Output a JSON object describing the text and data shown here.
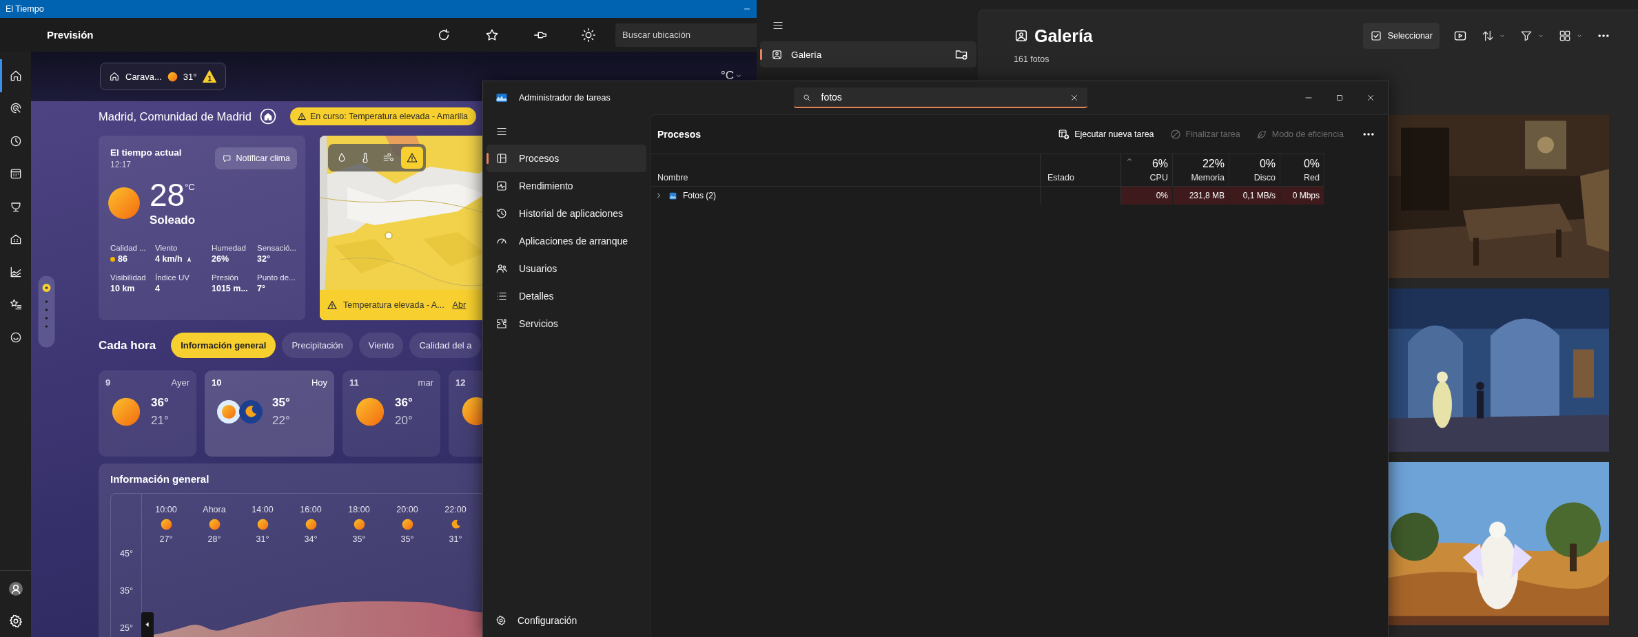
{
  "weather_app": {
    "window": {
      "title": "El Tiempo"
    },
    "header": {
      "title": "Previsión",
      "search": {
        "placeholder": "Buscar ubicación"
      }
    },
    "nav": [
      {
        "kind": "home",
        "selected": true
      },
      {
        "kind": "radar",
        "selected": false
      },
      {
        "kind": "clock",
        "selected": false
      },
      {
        "kind": "calendar",
        "selected": false
      },
      {
        "kind": "trophy",
        "selected": false
      },
      {
        "kind": "building",
        "selected": false
      },
      {
        "kind": "chart",
        "selected": false
      },
      {
        "kind": "starlist",
        "selected": false
      },
      {
        "kind": "smiley",
        "selected": false
      }
    ],
    "saved_location": {
      "name": "Carava...",
      "temp": "31°",
      "alerts": "1"
    },
    "unit": "°C",
    "location": "Madrid, Comunidad de Madrid",
    "alert": "En curso: Temperatura elevada - Amarilla",
    "current": {
      "title": "El tiempo actual",
      "time": "12:17",
      "notify": "Notificar clima",
      "temp": "28",
      "unit": "°C",
      "condition": "Soleado",
      "stats": [
        {
          "kind": "air",
          "label": "Calidad ...",
          "value": "86"
        },
        {
          "kind": "wind",
          "label": "Viento",
          "value": "4 km/h"
        },
        {
          "kind": "plain",
          "label": "Humedad",
          "value": "26%"
        },
        {
          "kind": "plain",
          "label": "Sensació...",
          "value": "32°"
        },
        {
          "kind": "plain",
          "label": "Visibilidad",
          "value": "10 km"
        },
        {
          "kind": "plain",
          "label": "Índice UV",
          "value": "4"
        },
        {
          "kind": "plain",
          "label": "Presión",
          "value": "1015 m..."
        },
        {
          "kind": "plain",
          "label": "Punto de...",
          "value": "7°"
        }
      ]
    },
    "map": {
      "layers": [
        {
          "kind": "precipitation",
          "selected": false
        },
        {
          "kind": "temperature",
          "selected": false
        },
        {
          "kind": "wind",
          "selected": false
        },
        {
          "kind": "alert",
          "selected": true
        }
      ],
      "alert": "Temperatura elevada - A...",
      "link": "Abr"
    },
    "hourly": {
      "title": "Cada hora",
      "tabs": [
        {
          "label": "Información general",
          "selected": true
        },
        {
          "label": "Precipitación",
          "selected": false
        },
        {
          "label": "Viento",
          "selected": false
        },
        {
          "label": "Calidad del a",
          "selected": false
        }
      ]
    },
    "days": [
      {
        "day": "9",
        "label": "Ayer",
        "kind": "sun",
        "high": "36°",
        "low": "21°",
        "selected": false
      },
      {
        "day": "10",
        "label": "Hoy",
        "kind": "day-night",
        "high": "35°",
        "low": "22°",
        "selected": true
      },
      {
        "day": "11",
        "label": "mar",
        "kind": "sun",
        "high": "36°",
        "low": "20°",
        "selected": false
      },
      {
        "day": "12",
        "kind": "sun",
        "selected": false
      }
    ],
    "overview": {
      "title": "Información general",
      "hours": [
        {
          "time": "10:00",
          "kind": "sun",
          "temp": "27°"
        },
        {
          "time": "Ahora",
          "kind": "sun",
          "temp": "28°"
        },
        {
          "time": "14:00",
          "kind": "sun",
          "temp": "31°"
        },
        {
          "time": "16:00",
          "kind": "sun",
          "temp": "34°"
        },
        {
          "time": "18:00",
          "kind": "sun",
          "temp": "35°"
        },
        {
          "time": "20:00",
          "kind": "sun",
          "temp": "35°"
        },
        {
          "time": "22:00",
          "kind": "moon",
          "temp": "31°"
        }
      ],
      "yticks": [
        "45°",
        "35°",
        "25°"
      ]
    }
  },
  "task_manager": {
    "title": "Administrador de tareas",
    "search": {
      "value": "fotos"
    },
    "nav": [
      {
        "kind": "processes",
        "label": "Procesos",
        "selected": true
      },
      {
        "kind": "performance",
        "label": "Rendimiento",
        "selected": false
      },
      {
        "kind": "history",
        "label": "Historial de aplicaciones",
        "selected": false
      },
      {
        "kind": "startup",
        "label": "Aplicaciones de arranque",
        "selected": false
      },
      {
        "kind": "users",
        "label": "Usuarios",
        "selected": false
      },
      {
        "kind": "details",
        "label": "Detalles",
        "selected": false
      },
      {
        "kind": "services",
        "label": "Servicios",
        "selected": false
      }
    ],
    "settings": "Configuración",
    "page_title": "Procesos",
    "actions": [
      {
        "kind": "run",
        "label": "Ejecutar nueva tarea",
        "disabled": false
      },
      {
        "kind": "end",
        "label": "Finalizar tarea",
        "disabled": true
      },
      {
        "kind": "efficiency",
        "label": "Modo de eficiencia",
        "disabled": true
      }
    ],
    "columns": [
      {
        "label": "Nombre"
      },
      {
        "label": "Estado"
      },
      {
        "label": "CPU",
        "total": "6%",
        "sorted": true
      },
      {
        "label": "Memoria",
        "total": "22%",
        "sorted": false
      },
      {
        "label": "Disco",
        "total": "0%",
        "sorted": false
      },
      {
        "label": "Red",
        "total": "0%",
        "sorted": false
      }
    ],
    "rows": [
      {
        "name": "Fotos (2)",
        "expanded": false,
        "values": [
          "0%",
          "231,8 MB",
          "0,1 MB/s",
          "0 Mbps"
        ]
      }
    ]
  },
  "photos_app": {
    "nav": [
      {
        "kind": "gallery",
        "label": "Galería",
        "selected": true
      }
    ],
    "title": "Galería",
    "count": "161 fotos",
    "select": "Seleccionar"
  }
}
